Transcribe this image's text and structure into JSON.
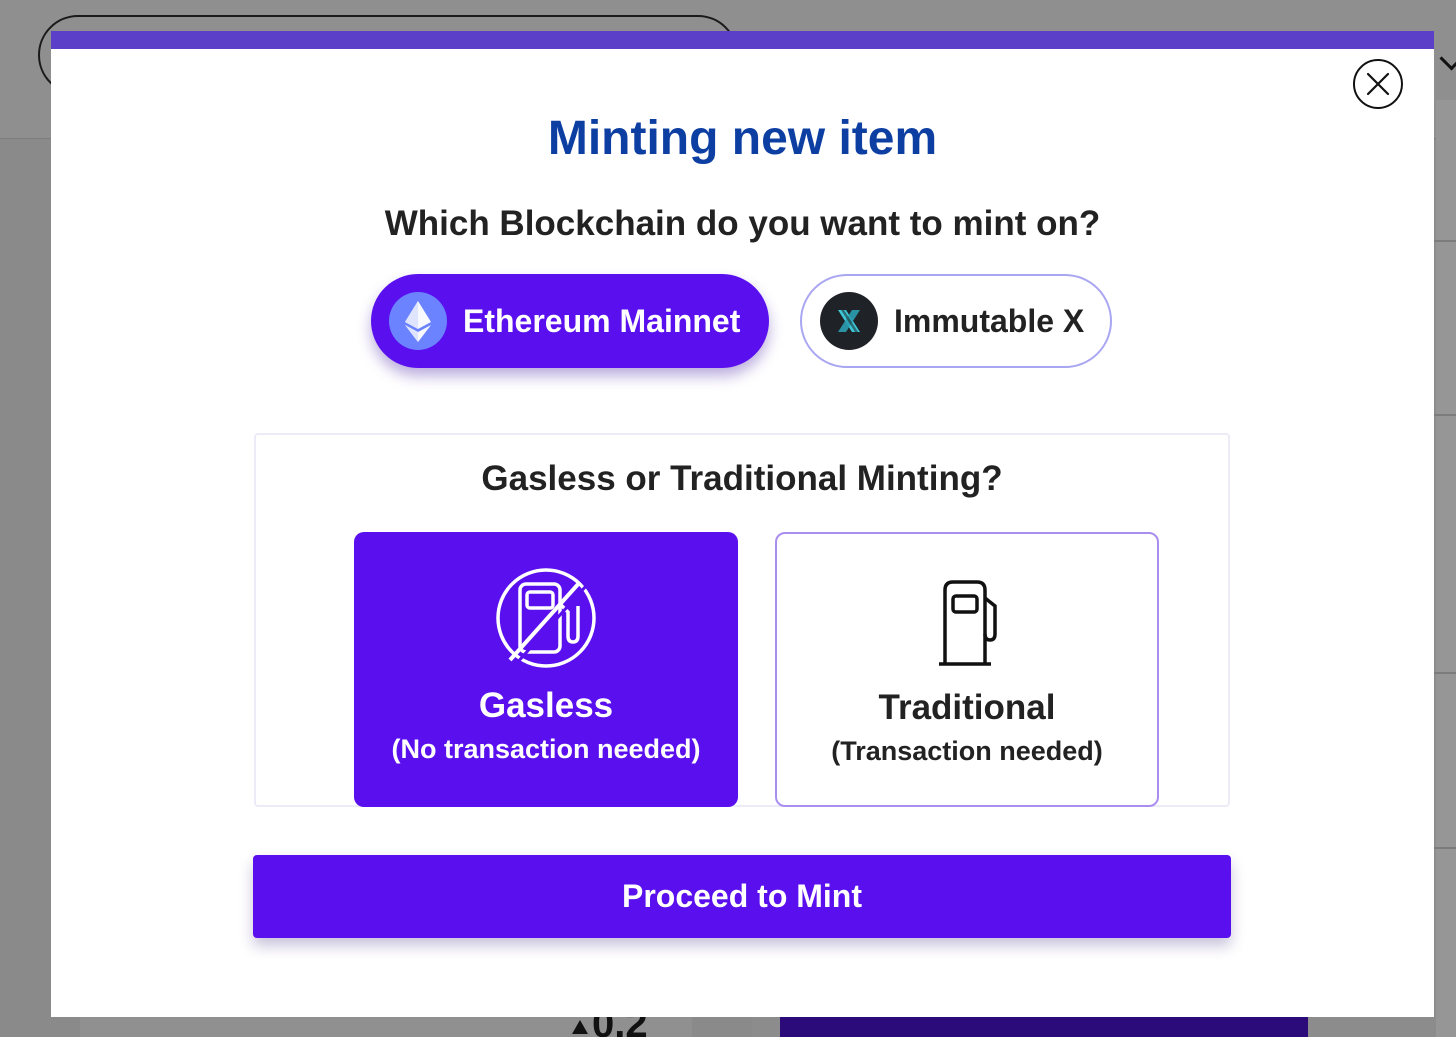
{
  "modal": {
    "title": "Minting new item",
    "close_icon": "close-circle-icon",
    "chain_question": "Which Blockchain do you want to mint on?",
    "chains": [
      {
        "label": "Ethereum Mainnet",
        "icon": "ethereum-icon",
        "selected": true
      },
      {
        "label": "Immutable X",
        "icon": "immutable-x-icon",
        "selected": false
      }
    ],
    "minting": {
      "title": "Gasless or Traditional Minting?",
      "options": [
        {
          "title": "Gasless",
          "subtitle": "(No transaction needed)",
          "icon": "no-gas-pump-icon",
          "selected": true
        },
        {
          "title": "Traditional",
          "subtitle": "(Transaction needed)",
          "icon": "gas-pump-icon",
          "selected": false
        }
      ]
    },
    "proceed_label": "Proceed to Mint"
  },
  "background": {
    "price": "0.2"
  },
  "colors": {
    "accent": "#5a0fee",
    "title": "#0d3fa3",
    "topbar": "#5b3fc8",
    "ethereum_icon_bg": "#6b83ff",
    "immutable_icon_bg": "#1f2226"
  }
}
